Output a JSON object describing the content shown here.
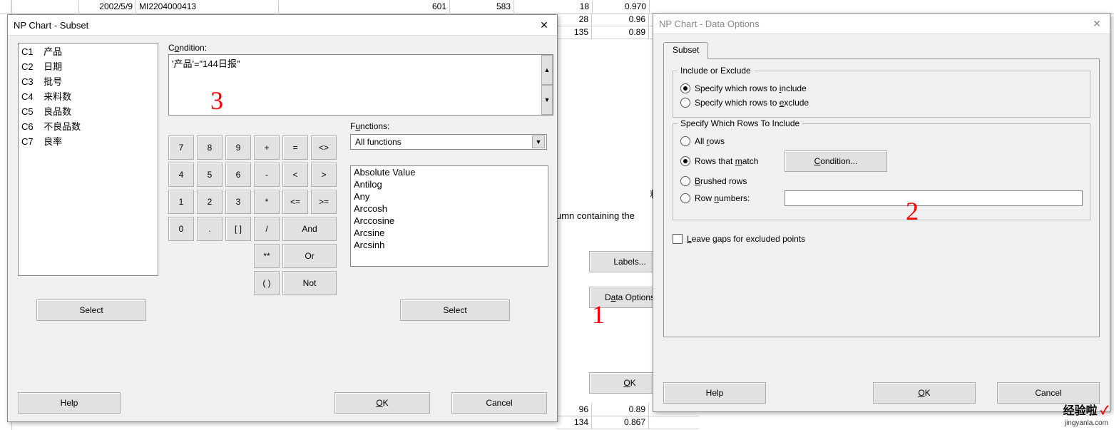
{
  "bg_header": {
    "date": "2002/5/9",
    "batch": "MI2204000413",
    "v1": "601",
    "v2": "583",
    "v3": "18",
    "v4": "0.970"
  },
  "bg_rows": [
    {
      "a": "28",
      "b": "0.96"
    },
    {
      "a": "135",
      "b": "0.89"
    }
  ],
  "bg_bottom": [
    {
      "a": "96",
      "b": "0.89"
    },
    {
      "a": "134",
      "b": "0.867"
    }
  ],
  "behind_dialog": {
    "field_value": "料数'",
    "hint": "umn containing the",
    "labels_button": "Labels...",
    "data_options_button": "Data Options",
    "ok_button": "OK"
  },
  "subset_dialog": {
    "title": "NP Chart - Subset",
    "columns": [
      "C1    产品",
      "C2    日期",
      "C3    批号",
      "C4    来料数",
      "C5    良品数",
      "C6    不良品数",
      "C7    良率"
    ],
    "condition_label_pre": "C",
    "condition_label_u": "o",
    "condition_label_post": "ndition:",
    "condition_value": "'产品'=\"144日报\"",
    "functions_label_pre": "F",
    "functions_label_u": "u",
    "functions_label_post": "nctions:",
    "functions_combo": "All functions",
    "function_items": [
      "Absolute Value",
      "Antilog",
      "Any",
      "Arccosh",
      "Arccosine",
      "Arcsine",
      "Arcsinh"
    ],
    "keypad": {
      "r1": [
        "7",
        "8",
        "9",
        "+",
        "=",
        "<>"
      ],
      "r2": [
        "4",
        "5",
        "6",
        "-",
        "<",
        ">"
      ],
      "r3": [
        "1",
        "2",
        "3",
        "*",
        "<=",
        ">="
      ],
      "r4": [
        "0",
        ".",
        "[ ]",
        "/",
        "And"
      ],
      "r5": [
        "**",
        "Or"
      ],
      "r6": [
        "( )",
        "Not"
      ]
    },
    "select1": "Select",
    "select2": "Select",
    "help": "Help",
    "ok_pre": "",
    "ok_u": "O",
    "ok_post": "K",
    "cancel": "Cancel"
  },
  "options_dialog": {
    "title": "NP Chart - Data Options",
    "tab": "Subset",
    "group1_title": "Include or Exclude",
    "opt_include_pre": "Specify which rows to ",
    "opt_include_u": "i",
    "opt_include_post": "nclude",
    "opt_exclude_pre": "Specify which rows to ",
    "opt_exclude_u": "e",
    "opt_exclude_post": "xclude",
    "group2_title": "Specify Which Rows To Include",
    "opt_all_pre": "All ",
    "opt_all_u": "r",
    "opt_all_post": "ows",
    "opt_match_pre": "Rows that ",
    "opt_match_u": "m",
    "opt_match_post": "atch",
    "condition_btn_u": "C",
    "condition_btn_post": "ondition...",
    "opt_brushed_u": "B",
    "opt_brushed_post": "rushed rows",
    "opt_numbers_pre": "Row ",
    "opt_numbers_u": "n",
    "opt_numbers_post": "umbers:",
    "leave_gaps_u": "L",
    "leave_gaps_post": "eave gaps for excluded points",
    "help": "Help",
    "ok_u": "O",
    "ok_post": "K",
    "cancel": "Cancel"
  },
  "annotations": {
    "a1": "1",
    "a2": "2",
    "a3": "3"
  },
  "watermark": {
    "main": "经验啦",
    "site": "jingyanla.com"
  }
}
